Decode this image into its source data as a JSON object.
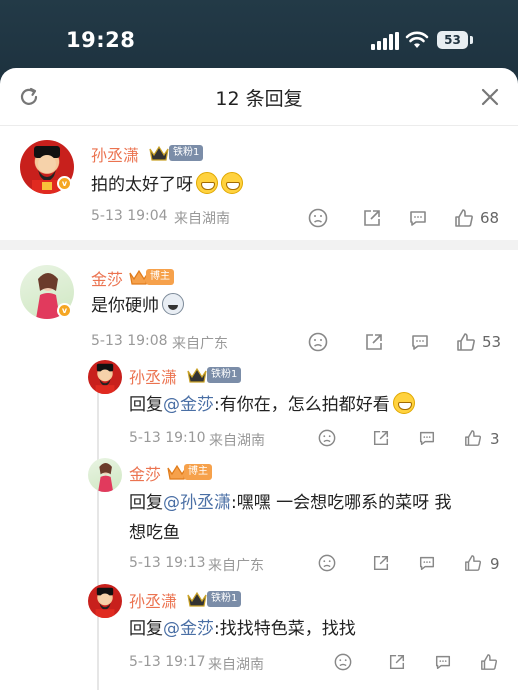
{
  "status_bar": {
    "time": "19:28",
    "battery": "53"
  },
  "header": {
    "title": "12 条回复"
  },
  "comments": [
    {
      "user": "孙丞潇",
      "badge": "铁粉1",
      "text": "拍的太好了呀",
      "time": "5-13 19:04",
      "location": "来自湖南",
      "likes": "68"
    },
    {
      "user": "金莎",
      "badge": "博主",
      "text": "是你硬帅",
      "time": "5-13 19:08",
      "location": "来自广东",
      "likes": "53"
    }
  ],
  "replies": [
    {
      "user": "孙丞潇",
      "badge": "铁粉1",
      "prefix": "回复",
      "mention": "@金莎",
      "text": ":有你在，怎么拍都好看",
      "time": "5-13 19:10",
      "location": "来自湖南",
      "likes": "3"
    },
    {
      "user": "金莎",
      "badge": "博主",
      "prefix": "回复",
      "mention": "@孙丞潇",
      "text": ":嘿嘿 一会想吃哪系的菜呀 我",
      "text2": "想吃鱼",
      "time": "5-13 19:13",
      "location": "来自广东",
      "likes": "9"
    },
    {
      "user": "孙丞潇",
      "badge": "铁粉1",
      "prefix": "回复",
      "mention": "@金莎",
      "text": ":找找特色菜，找找",
      "time": "5-13 19:17",
      "location": "来自湖南",
      "likes": ""
    }
  ],
  "colors": {
    "username": "#eb7350",
    "mention": "#4a6fa5",
    "meta": "#999999"
  }
}
